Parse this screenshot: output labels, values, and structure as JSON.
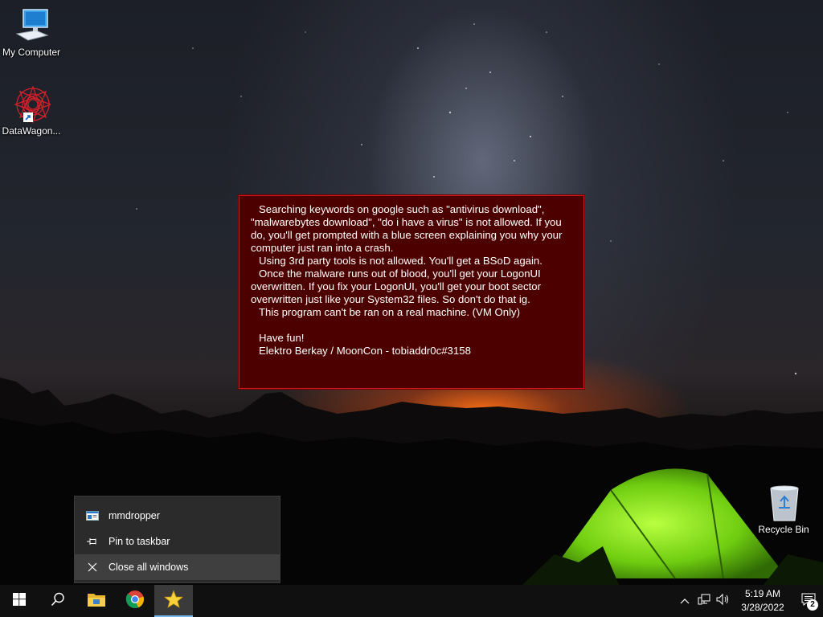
{
  "desktop": {
    "icons": [
      {
        "label": "My Computer",
        "icon": "computer-icon"
      },
      {
        "label": "DataWagon...",
        "icon": "mandala-shortcut-icon"
      },
      {
        "label": "Recycle Bin",
        "icon": "recycle-bin-icon"
      }
    ]
  },
  "message": {
    "lines": [
      "Searching keywords on google such as \"antivirus download\", \"malwarebytes download\", \"do i have a virus\" is not allowed. If you do, you'll get prompted with a blue screen explaining you why your computer just ran into a crash.",
      "Using 3rd party tools is not allowed. You'll get a BSoD again.",
      "Once the malware runs out of blood, you'll get your LogonUI overwritten. If you fix your LogonUI, you'll get your boot sector overwritten just like your System32 files. So don't do that ig.",
      "This program can't be ran on a real machine. (VM Only)",
      "Have fun!",
      "Elektro Berkay / MoonCon - tobiaddr0c#3158"
    ]
  },
  "jumplist": {
    "items": [
      {
        "label": "mmdropper",
        "icon": "app-window-icon"
      },
      {
        "label": "Pin to taskbar",
        "icon": "pin-icon"
      },
      {
        "label": "Close all windows",
        "icon": "close-icon"
      }
    ]
  },
  "taskbar": {
    "apps": [
      {
        "name": "start",
        "icon": "windows-logo-icon"
      },
      {
        "name": "search",
        "icon": "search-icon"
      },
      {
        "name": "file-explorer",
        "icon": "folder-icon"
      },
      {
        "name": "chrome",
        "icon": "chrome-icon"
      },
      {
        "name": "mmdropper",
        "icon": "star-icon",
        "active": true
      }
    ],
    "time": "5:19 AM",
    "date": "3/28/2022",
    "notification_count": "2"
  },
  "colors": {
    "message_bg": "#4d0000",
    "message_border": "#d21818",
    "taskbar_bg": "#101010",
    "accent": "#76b9ed"
  }
}
